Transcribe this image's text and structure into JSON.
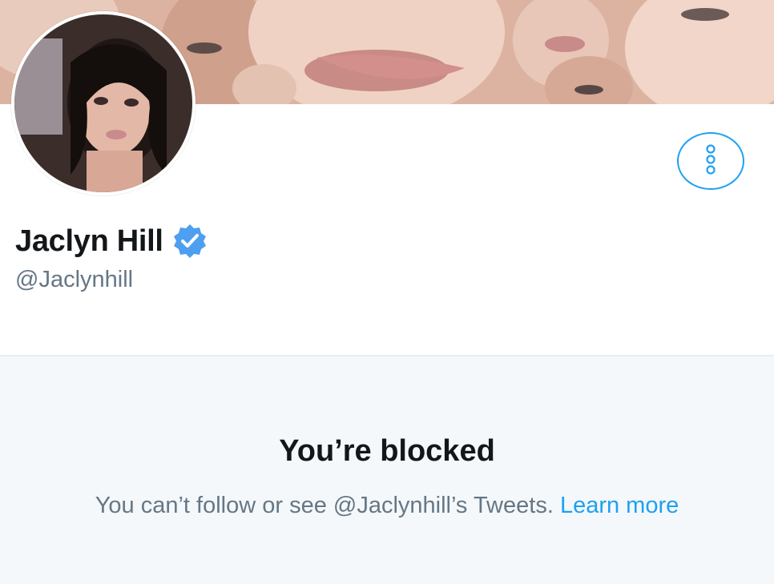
{
  "profile": {
    "display_name": "Jaclyn Hill",
    "handle": "@Jaclynhill",
    "verified": true
  },
  "icons": {
    "verified": "verified-badge-icon",
    "more": "more-vertical-icon"
  },
  "blocked": {
    "title": "You’re blocked",
    "message_prefix": "You can’t follow or see @Jaclynhill’s Tweets.",
    "learn_more": "Learn more"
  },
  "colors": {
    "accent": "#1da1f2",
    "verified": "#4d9ff0",
    "text_primary": "#14171a",
    "text_secondary": "#657786",
    "panel_bg": "#f5f8fa"
  }
}
